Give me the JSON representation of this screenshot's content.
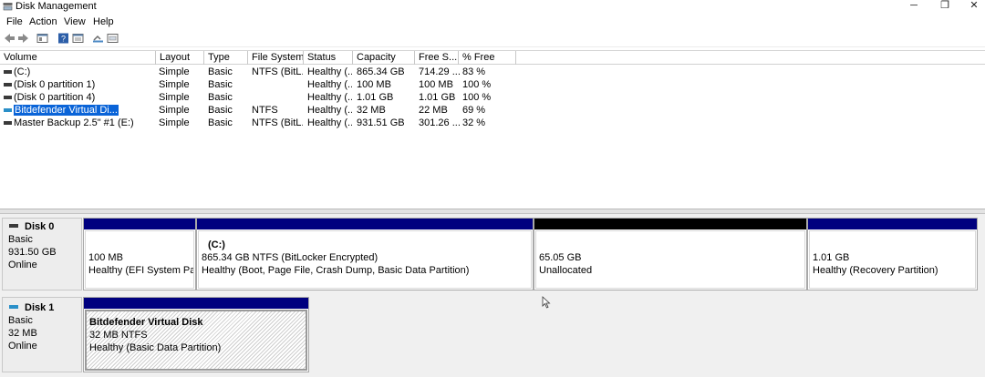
{
  "window": {
    "title": "Disk Management",
    "minimize": "─",
    "maximize": "❐",
    "close": "✕"
  },
  "menu": [
    "File",
    "Action",
    "View",
    "Help"
  ],
  "toolbar_icons": [
    "back-icon",
    "forward-icon",
    "disk-view-icon",
    "help-icon",
    "properties-icon",
    "rescan-icon",
    "settings-icon"
  ],
  "columns": [
    "Volume",
    "Layout",
    "Type",
    "File System",
    "Status",
    "Capacity",
    "Free S...",
    "% Free"
  ],
  "volumes": [
    {
      "name": "(C:)",
      "layout": "Simple",
      "type": "Basic",
      "fs": "NTFS (BitL...",
      "status": "Healthy (...",
      "capacity": "865.34 GB",
      "free": "714.29 ...",
      "pct": "83 %",
      "icon": "dark"
    },
    {
      "name": "(Disk 0 partition 1)",
      "layout": "Simple",
      "type": "Basic",
      "fs": "",
      "status": "Healthy (...",
      "capacity": "100 MB",
      "free": "100 MB",
      "pct": "100 %",
      "icon": "dark"
    },
    {
      "name": "(Disk 0 partition 4)",
      "layout": "Simple",
      "type": "Basic",
      "fs": "",
      "status": "Healthy (...",
      "capacity": "1.01 GB",
      "free": "1.01 GB",
      "pct": "100 %",
      "icon": "dark"
    },
    {
      "name": "Bitdefender Virtual Di...",
      "layout": "Simple",
      "type": "Basic",
      "fs": "NTFS",
      "status": "Healthy (...",
      "capacity": "32 MB",
      "free": "22 MB",
      "pct": "69 %",
      "icon": "blue",
      "selected": true
    },
    {
      "name": "Master Backup 2.5\" #1 (E:)",
      "layout": "Simple",
      "type": "Basic",
      "fs": "NTFS (BitL...",
      "status": "Healthy (...",
      "capacity": "931.51 GB",
      "free": "301.26 ...",
      "pct": "32 %",
      "icon": "dark"
    }
  ],
  "disks": [
    {
      "name": "Disk 0",
      "type": "Basic",
      "size": "931.50 GB",
      "state": "Online",
      "partitions": [
        {
          "title": "",
          "line1": "100 MB",
          "line2": "Healthy (EFI System Partiti"
        },
        {
          "title": "(C:)",
          "line1": "865.34 GB NTFS (BitLocker Encrypted)",
          "line2": "Healthy (Boot, Page File, Crash Dump, Basic Data Partition)"
        },
        {
          "title": "",
          "line1": "65.05 GB",
          "line2": "Unallocated"
        },
        {
          "title": "",
          "line1": "1.01 GB",
          "line2": "Healthy (Recovery Partition)"
        }
      ]
    },
    {
      "name": "Disk 1",
      "type": "Basic",
      "size": "32 MB",
      "state": "Online",
      "partitions": [
        {
          "title": "Bitdefender Virtual Disk",
          "line1": "32 MB NTFS",
          "line2": "Healthy (Basic Data Partition)"
        }
      ]
    }
  ],
  "colors": {
    "primary_partition": "#00007f",
    "unallocated": "#000000",
    "selection": "#0a64d8"
  }
}
